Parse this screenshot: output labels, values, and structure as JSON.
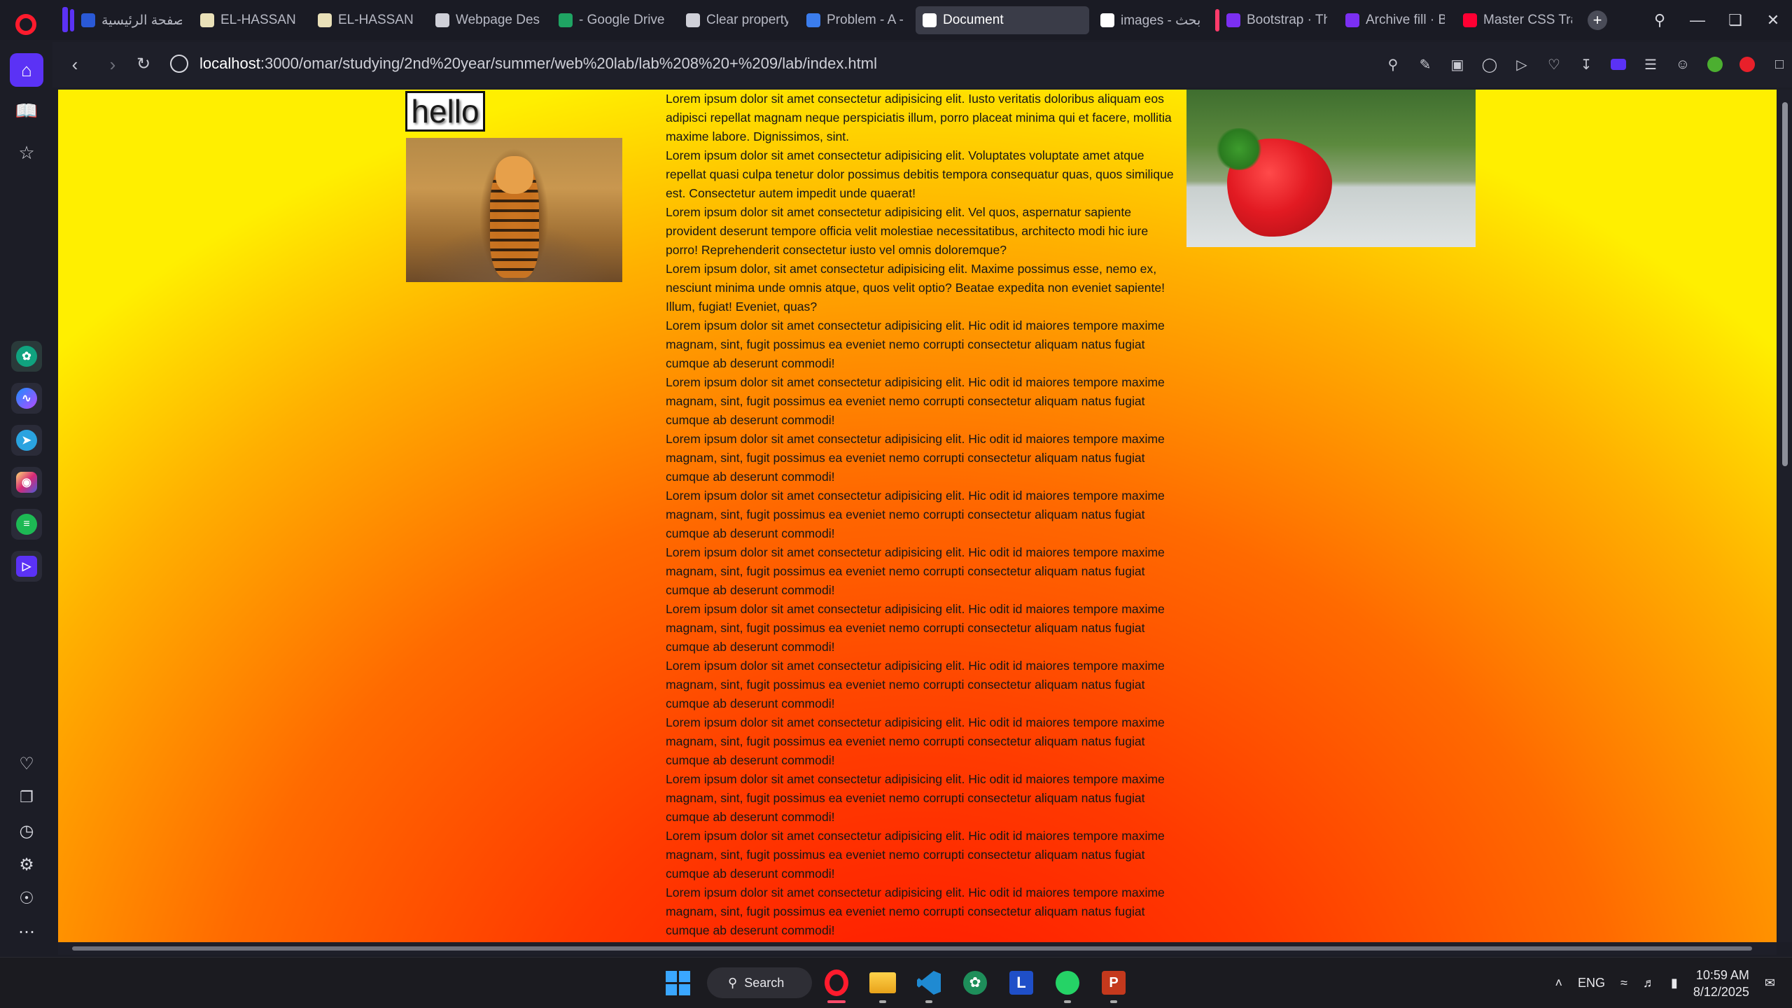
{
  "browser": {
    "tabs": [
      {
        "label": "الصفحة الرئيسية",
        "icon": "site-icon",
        "color": "#2a59d6",
        "group": "#5b32f5"
      },
      {
        "label": "EL-HASSAN LIB",
        "icon": "k-icon",
        "color": "#e9e0b8"
      },
      {
        "label": "EL-HASSAN LIB",
        "icon": "k-icon",
        "color": "#e9e0b8"
      },
      {
        "label": "Webpage Desig",
        "icon": "globe-icon",
        "color": "#cfd0d8"
      },
      {
        "label": "- Google Drive",
        "icon": "drive-icon",
        "color": "#1fa463"
      },
      {
        "label": "Clear property",
        "icon": "openai-icon",
        "color": "#cfd0d8"
      },
      {
        "label": "Problem - A - C",
        "icon": "bar-chart-icon",
        "color": "#3b7ded"
      },
      {
        "label": "Document",
        "icon": "globe-icon",
        "color": "#ffffff",
        "active": true
      },
      {
        "label": "images - بحث G",
        "icon": "google-icon",
        "color": "#ffffff"
      },
      {
        "label": "Bootstrap · The",
        "icon": "bootstrap-icon",
        "color": "#7b2ff2",
        "group": "#ff3b6b"
      },
      {
        "label": "Archive fill · Boo",
        "icon": "bootstrap-icon",
        "color": "#7b2ff2"
      },
      {
        "label": "Master CSS Tran",
        "icon": "youtube-icon",
        "color": "#ff0033"
      }
    ],
    "url": {
      "host": "localhost",
      "rest": ":3000/omar/studying/2nd%20year/summer/web%20lab/lab%208%20+%209/lab/index.html"
    }
  },
  "page": {
    "hello_text": "hello",
    "paragraphs": [
      "Lorem ipsum dolor sit amet consectetur adipisicing elit. Iusto veritatis doloribus aliquam eos adipisci repellat magnam neque perspiciatis illum, porro placeat minima qui et facere, mollitia maxime labore. Dignissimos, sint.",
      "Lorem ipsum dolor sit amet consectetur adipisicing elit. Voluptates voluptate amet atque repellat quasi culpa tenetur dolor possimus debitis tempora consequatur quas, quos similique est. Consectetur autem impedit unde quaerat!",
      "Lorem ipsum dolor sit amet consectetur adipisicing elit. Vel quos, aspernatur sapiente provident deserunt tempore officia velit molestiae necessitatibus, architecto modi hic iure porro! Reprehenderit consectetur iusto vel omnis doloremque?",
      "Lorem ipsum dolor, sit amet consectetur adipisicing elit. Maxime possimus esse, nemo ex, nesciunt minima unde omnis atque, quos velit optio? Beatae expedita non eveniet sapiente! Illum, fugiat! Eveniet, quas?",
      "Lorem ipsum dolor sit amet consectetur adipisicing elit. Hic odit id maiores tempore maxime magnam, sint, fugit possimus ea eveniet nemo corrupti consectetur aliquam natus fugiat cumque ab deserunt commodi!",
      "Lorem ipsum dolor sit amet consectetur adipisicing elit. Hic odit id maiores tempore maxime magnam, sint, fugit possimus ea eveniet nemo corrupti consectetur aliquam natus fugiat cumque ab deserunt commodi!",
      "Lorem ipsum dolor sit amet consectetur adipisicing elit. Hic odit id maiores tempore maxime magnam, sint, fugit possimus ea eveniet nemo corrupti consectetur aliquam natus fugiat cumque ab deserunt commodi!",
      "Lorem ipsum dolor sit amet consectetur adipisicing elit. Hic odit id maiores tempore maxime magnam, sint, fugit possimus ea eveniet nemo corrupti consectetur aliquam natus fugiat cumque ab deserunt commodi!",
      "Lorem ipsum dolor sit amet consectetur adipisicing elit. Hic odit id maiores tempore maxime magnam, sint, fugit possimus ea eveniet nemo corrupti consectetur aliquam natus fugiat cumque ab deserunt commodi!",
      "Lorem ipsum dolor sit amet consectetur adipisicing elit. Hic odit id maiores tempore maxime magnam, sint, fugit possimus ea eveniet nemo corrupti consectetur aliquam natus fugiat cumque ab deserunt commodi!",
      "Lorem ipsum dolor sit amet consectetur adipisicing elit. Hic odit id maiores tempore maxime magnam, sint, fugit possimus ea eveniet nemo corrupti consectetur aliquam natus fugiat cumque ab deserunt commodi!",
      "Lorem ipsum dolor sit amet consectetur adipisicing elit. Hic odit id maiores tempore maxime magnam, sint, fugit possimus ea eveniet nemo corrupti consectetur aliquam natus fugiat cumque ab deserunt commodi!",
      "Lorem ipsum dolor sit amet consectetur adipisicing elit. Hic odit id maiores tempore maxime magnam, sint, fugit possimus ea eveniet nemo corrupti consectetur aliquam natus fugiat cumque ab deserunt commodi!",
      "Lorem ipsum dolor sit amet consectetur adipisicing elit. Hic odit id maiores tempore maxime magnam, sint, fugit possimus ea eveniet nemo corrupti consectetur aliquam natus fugiat cumque ab deserunt commodi!",
      "Lorem ipsum dolor sit amet consectetur adipisicing elit. Hic odit id maiores tempore maxime magnam, sint, fugit possimus ea eveniet nemo corrupti consectetur aliquam natus fugiat cumque ab deserunt commodi!"
    ]
  },
  "taskbar": {
    "search_label": "Search",
    "language": "ENG",
    "time": "10:59 AM",
    "date": "8/12/2025"
  }
}
